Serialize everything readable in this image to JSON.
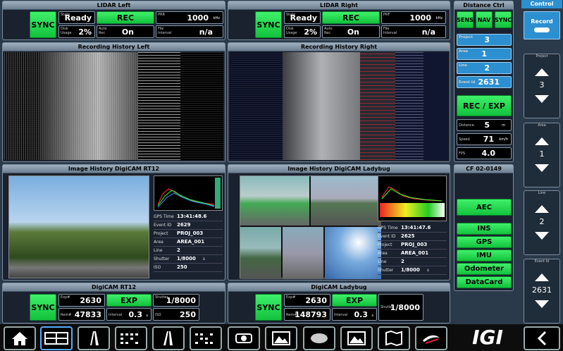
{
  "lidar_left": {
    "title": "LIDAR Left",
    "sync": "SYNC",
    "state_label": "State",
    "state": "Ready",
    "rec": "REC",
    "prr_label": "PRR",
    "prr": "1000",
    "prr_unit": "kHz",
    "disk_label": "Disk Usage",
    "disk": "2%",
    "autorec_label": "Auto Rec",
    "autorec": "On",
    "file_label": "File Interval",
    "file": "n/a"
  },
  "lidar_right": {
    "title": "LIDAR Right",
    "sync": "SYNC",
    "state_label": "State",
    "state": "Ready",
    "rec": "REC",
    "prr_label": "PRF",
    "prr": "1000",
    "prr_unit": "kHz",
    "disk_label": "Disk Usage",
    "disk": "2%",
    "autorec_label": "Auto Rec",
    "autorec": "On",
    "file_label": "File Interval",
    "file": "n/a"
  },
  "rec_hist_left": {
    "title": "Recording History Left"
  },
  "rec_hist_right": {
    "title": "Recording History Right"
  },
  "distance_ctrl": {
    "title": "Distance Ctrl",
    "sens": "SENS",
    "nav": "NAV",
    "sync": "SYNC",
    "project_label": "Project",
    "project": "3",
    "area_label": "Area",
    "area": "1",
    "line_label": "Line",
    "line": "2",
    "event_label": "Event Id",
    "event": "2631",
    "rec_exp": "REC / EXP",
    "distance_label": "Distance",
    "distance": "5",
    "distance_unit": "m",
    "speed_label": "Speed",
    "speed": "71",
    "speed_unit": "km/h",
    "fps_label": "FPS",
    "fps": "4.0"
  },
  "img_rt12": {
    "title": "Image History DigiCAM RT12",
    "rows": [
      [
        "GPS Time",
        "13:41:48.6"
      ],
      [
        "Event ID",
        "2629"
      ],
      [
        "Project",
        "PROJ_003"
      ],
      [
        "Area",
        "AREA_001"
      ],
      [
        "Line",
        "2"
      ],
      [
        "Shutter",
        "1/8000"
      ],
      [
        "ISO",
        "250"
      ]
    ],
    "shutter_unit": "s"
  },
  "img_ladybug": {
    "title": "Image History DigiCAM Ladybug",
    "rows": [
      [
        "GPS Time",
        "13:41:47.6"
      ],
      [
        "Event ID",
        "2625"
      ],
      [
        "Project",
        "PROJ_003"
      ],
      [
        "Area",
        "AREA_001"
      ],
      [
        "Line",
        "2"
      ],
      [
        "Shutter",
        "1/8000"
      ]
    ],
    "shutter_unit": "s"
  },
  "cf": {
    "title": "CF 02-0149",
    "aec": "AEC",
    "ins": "INS",
    "gps": "GPS",
    "imu": "IMU",
    "odometer": "Odometer",
    "datacard": "DataCard"
  },
  "digicam_rt12": {
    "title": "DigiCAM RT12",
    "sync": "SYNC",
    "exp_label": "Exp#",
    "exp": "2630",
    "exp_btn": "EXP",
    "shutter_label": "Shutter",
    "shutter": "1/8000",
    "rem_label": "Rem#",
    "rem": "47833",
    "interval_label": "Interval",
    "interval": "0.3",
    "interval_unit": "s",
    "iso_label": "ISO",
    "iso": "250"
  },
  "digicam_ladybug": {
    "title": "DigiCAM Ladybug",
    "sync": "SYNC",
    "exp_label": "Exp#",
    "exp": "2630",
    "exp_btn": "EXP",
    "shutter_label": "Shutter",
    "shutter": "1/8000",
    "rem_label": "Rem#",
    "rem": "148793",
    "interval_label": "Interval",
    "interval": "0.3",
    "interval_unit": "s"
  },
  "control": {
    "title": "Control",
    "record": "Record",
    "project_label": "Project",
    "project": "3",
    "area_label": "Area",
    "area": "1",
    "line_label": "Line",
    "line": "2",
    "event_label": "Event Id",
    "event": "2631"
  },
  "brand": "IGI",
  "toolbar_icons": [
    "home-icon",
    "layout-grid-icon",
    "road-icon",
    "dots-grid-icon",
    "road2-icon",
    "dots-grid2-icon",
    "camera-icon",
    "image-icon",
    "car-icon",
    "image2-icon",
    "map-icon",
    "aero-icon"
  ]
}
